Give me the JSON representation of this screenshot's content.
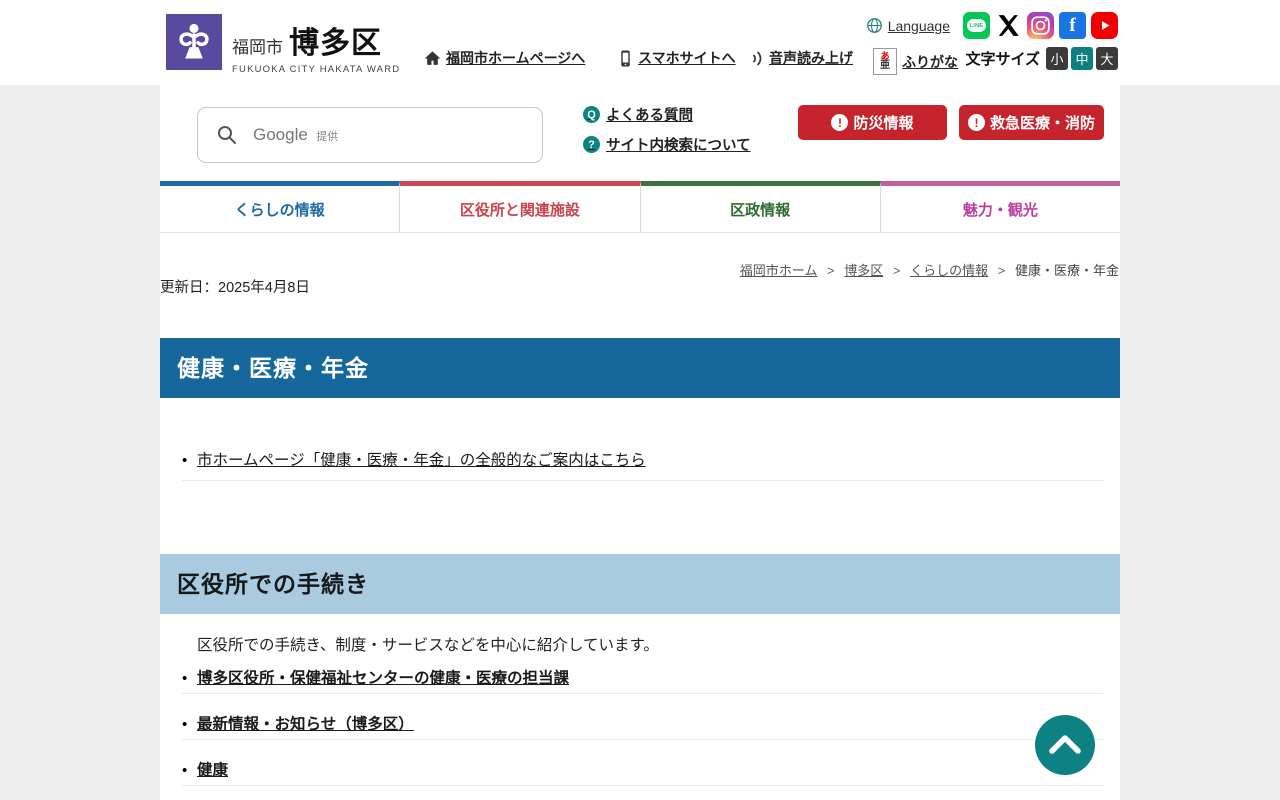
{
  "header": {
    "logo": {
      "city": "福岡市",
      "ward": "博多区",
      "subtitle": "FUKUOKA CITY HAKATA WARD"
    },
    "language_label": "Language",
    "city_home_link": "福岡市ホームページへ",
    "mobile_link": "スマホサイトへ",
    "speech_link": "音声読み上げ",
    "furigana_link": "ふりがな",
    "furigana_icon_top": "あ",
    "furigana_icon_bottom": "亜",
    "font_size_label": "文字サイズ",
    "font_size_small": "小",
    "font_size_medium": "中",
    "font_size_large": "大",
    "social": {
      "line_glyph": "LINE",
      "facebook_glyph": "f"
    }
  },
  "search": {
    "placeholder_main": "Google",
    "placeholder_sub": "提供",
    "faq_icon": "Q",
    "faq_label": "よくある質問",
    "site_search_icon": "?",
    "site_search_label": "サイト内検索について",
    "alert_icon": "!",
    "disaster_button": "防災情報",
    "emergency_button": "救急医療・消防"
  },
  "nav_tabs": [
    {
      "label": "くらしの情報"
    },
    {
      "label": "区役所と関連施設"
    },
    {
      "label": "区政情報"
    },
    {
      "label": "魅力・観光"
    }
  ],
  "breadcrumb": {
    "separator": ">",
    "items": [
      {
        "label": "福岡市ホーム"
      },
      {
        "label": "博多区"
      },
      {
        "label": "くらしの情報"
      },
      {
        "label": "健康・医療・年金"
      }
    ]
  },
  "updated_date": "更新日：2025年4月8日",
  "main": {
    "title": "健康・医療・年金",
    "general_guide_link": "市ホームページ「健康・医療・年金」の全般的なご案内はこちら",
    "section_title": "区役所での手続き",
    "section_description": "区役所での手続き、制度・サービスなどを中心に紹介しています。",
    "links": [
      {
        "label": "博多区役所・保健福祉センターの健康・医療の担当課"
      },
      {
        "label": "最新情報・お知らせ（博多区）"
      },
      {
        "label": "健康"
      }
    ]
  },
  "colors": {
    "title_bar_blue": "#16689c",
    "section_bar_lightblue": "#a9cadf",
    "alert_red": "#c5242c",
    "teal_accent": "#0e8384",
    "tab_living_blue": "#1e6ba3",
    "tab_office_red": "#c94a51",
    "tab_government_green": "#3f7240",
    "tab_tourism_pink": "#c160a3",
    "logo_purple": "#584a9e"
  }
}
